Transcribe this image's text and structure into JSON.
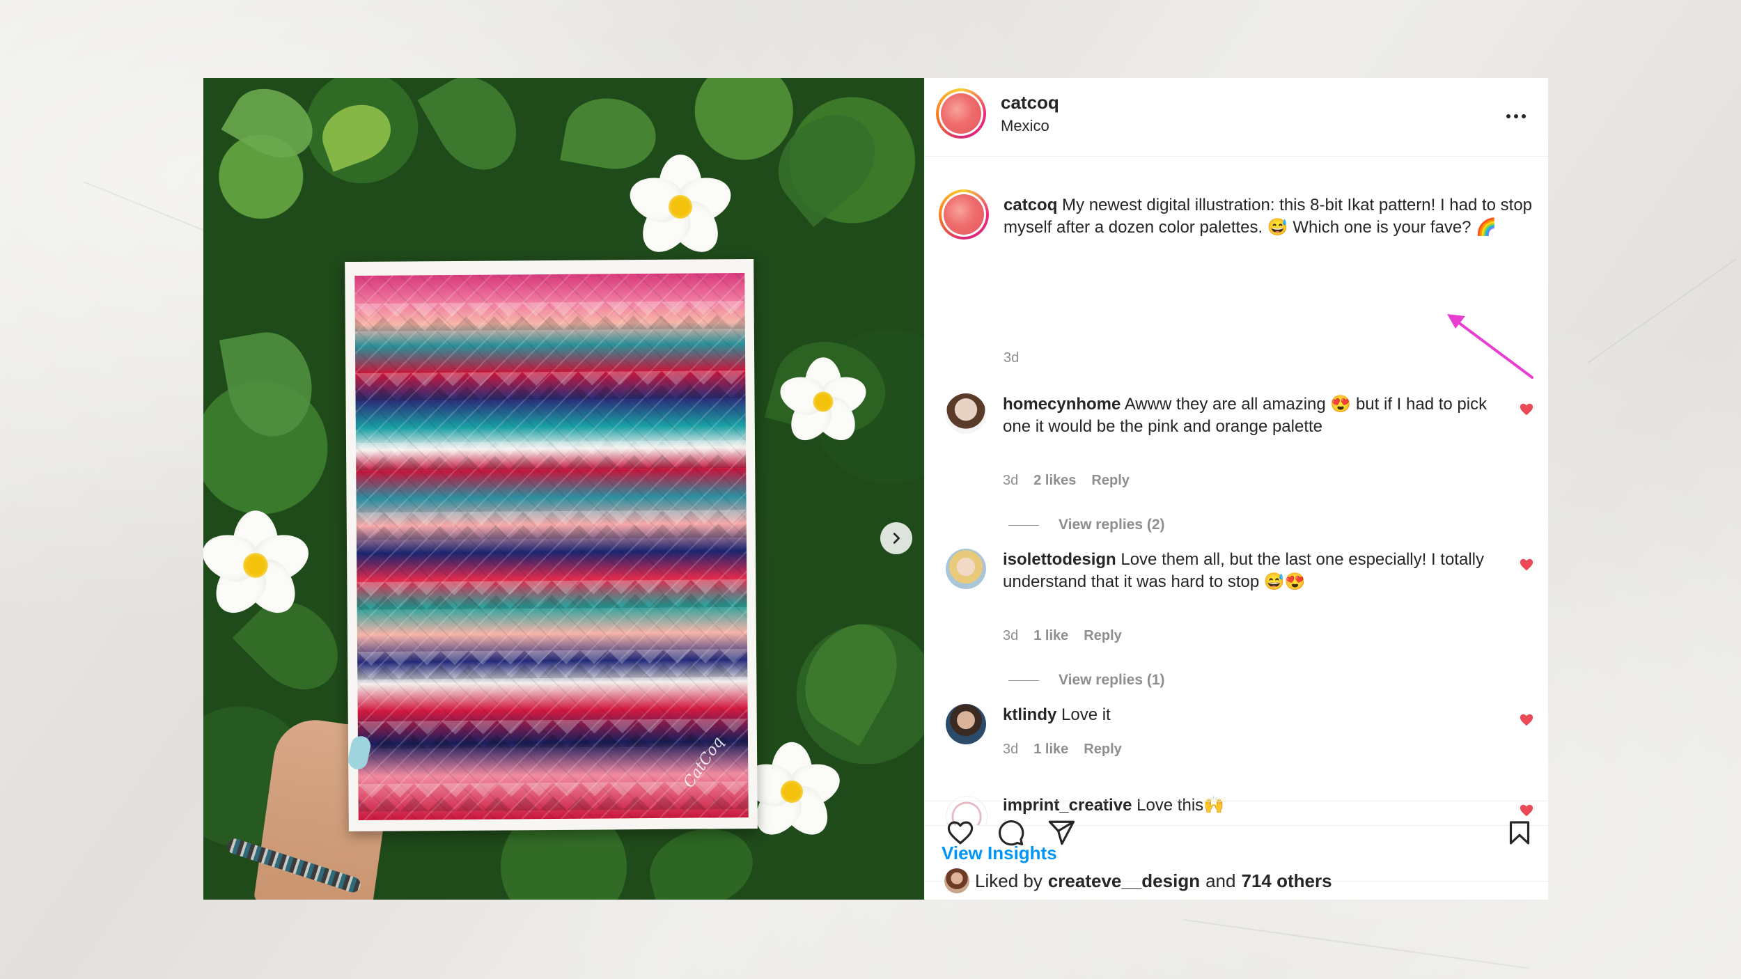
{
  "post": {
    "author": "catcoq",
    "location": "Mexico",
    "caption_user": "catcoq",
    "caption_text": "My newest digital illustration: this 8-bit Ikat pattern! I had to stop myself after a dozen color palettes. 😅 Which one is your fave? 🌈",
    "caption_time": "3d",
    "artwork_signature": "CatCoq"
  },
  "comments": [
    {
      "user": "homecynhome",
      "text": "Awww they are all amazing 😍 but if I had to pick one it would be the pink and orange palette",
      "time": "3d",
      "likes": "2 likes",
      "reply": "Reply",
      "view_replies": "View replies (2)"
    },
    {
      "user": "isolettodesign",
      "text": "Love them all, but the last one especially! I totally understand that it was hard to stop 😅😍",
      "time": "3d",
      "likes": "1 like",
      "reply": "Reply",
      "view_replies": "View replies (1)"
    },
    {
      "user": "ktlindy",
      "text": "Love it",
      "time": "3d",
      "likes": "1 like",
      "reply": "Reply"
    },
    {
      "user": "imprint_creative",
      "text": "Love this🙌"
    }
  ],
  "insights_label": "View Insights",
  "liked_by": {
    "prefix": "Liked by",
    "user": "createve__design",
    "conj": "and",
    "others": "714 others"
  },
  "colors": {
    "accent_blue": "#0095f6",
    "heart_red": "#ed4956",
    "annotation_pink": "#e93fd0",
    "muted_text": "#8e8e8e"
  },
  "icons": [
    "chevron-right-icon",
    "more-icon",
    "heart-icon",
    "comment-icon",
    "share-icon",
    "bookmark-icon"
  ]
}
